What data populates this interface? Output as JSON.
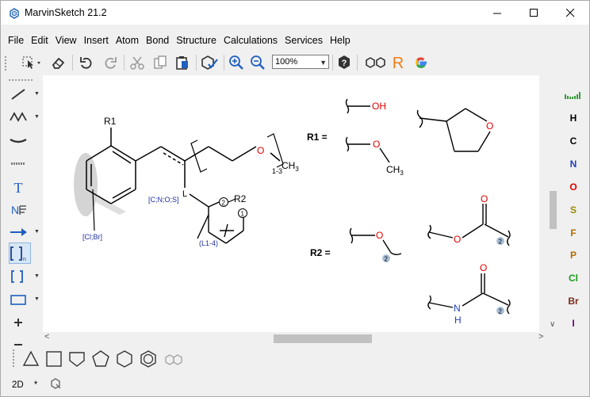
{
  "window": {
    "title": "MarvinSketch 21.2"
  },
  "menu": [
    "File",
    "Edit",
    "View",
    "Insert",
    "Atom",
    "Bond",
    "Structure",
    "Calculations",
    "Services",
    "Help"
  ],
  "toolbar": {
    "zoom_value": "100%"
  },
  "elements": [
    "H",
    "C",
    "N",
    "O",
    "S",
    "F",
    "P",
    "Cl",
    "Br",
    "I"
  ],
  "element_colors": {
    "H": "#000000",
    "C": "#000000",
    "N": "#1f3fbf",
    "O": "#e00000",
    "S": "#9a8a00",
    "F": "#b26b00",
    "P": "#b26b00",
    "Cl": "#1b9a1b",
    "Br": "#7a2a1a",
    "I": "#6a007a"
  },
  "status": {
    "mode": "2D",
    "star": "*"
  },
  "structure": {
    "r1_atom": "R1",
    "r2_atom": "R2",
    "atom_list_top": "[C;N;O;S]",
    "atom_list_bottom": "[Cl;Br]",
    "link_range": "(L1-4)",
    "repeat_range": "1-3",
    "methyl": "CH",
    "methyl_sub": "3",
    "attach_2": "2",
    "attach_1": "1",
    "ring_atom_L": "L",
    "oxygen": "O"
  },
  "rgroups": {
    "r1_label": "R1 =",
    "r2_label": "R2 =",
    "oh": "OH",
    "o": "O",
    "ch3": "CH",
    "ch3_sub": "3",
    "nh_n": "N",
    "nh_h": "H",
    "attach_2": "2"
  }
}
